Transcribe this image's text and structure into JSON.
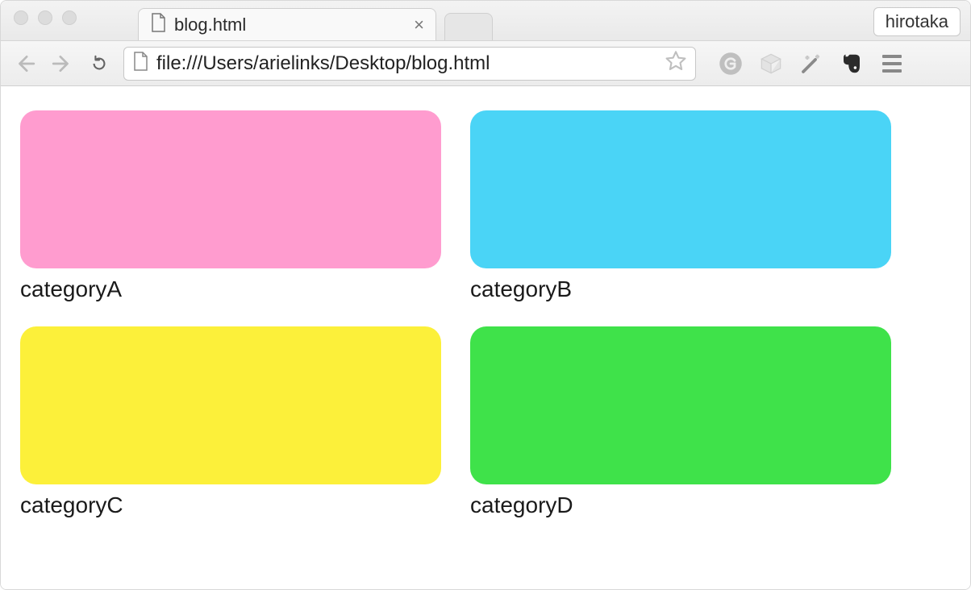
{
  "window": {
    "user_label": "hirotaka"
  },
  "tab": {
    "title": "blog.html",
    "close_glyph": "×"
  },
  "toolbar": {
    "url": "file:///Users/arielinks/Desktop/blog.html"
  },
  "page": {
    "cards": [
      {
        "label": "categoryA",
        "color": "#ff9ccf"
      },
      {
        "label": "categoryB",
        "color": "#4ad4f6"
      },
      {
        "label": "categoryC",
        "color": "#fcf03a"
      },
      {
        "label": "categoryD",
        "color": "#3fe24a"
      }
    ]
  }
}
